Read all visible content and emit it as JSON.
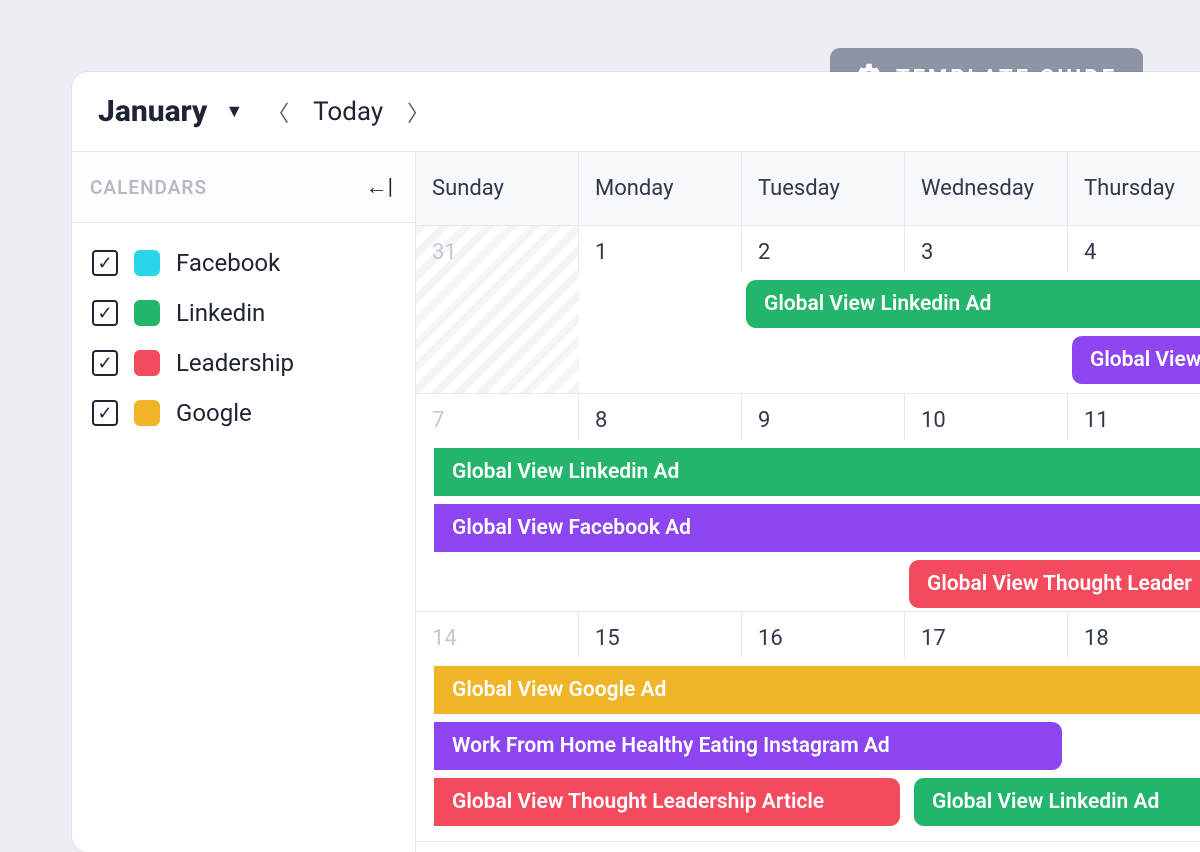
{
  "template_guide_label": "TEMPLATE GUIDE",
  "toolbar": {
    "month": "January",
    "today_label": "Today"
  },
  "sidebar": {
    "title": "CALENDARS",
    "items": [
      {
        "label": "Facebook",
        "color": "#29d5e8",
        "checked": true
      },
      {
        "label": "Linkedin",
        "color": "#24b56c",
        "checked": true
      },
      {
        "label": "Leadership",
        "color": "#f34a5e",
        "checked": true
      },
      {
        "label": "Google",
        "color": "#f0b429",
        "checked": true
      }
    ]
  },
  "day_headers": [
    "Sunday",
    "Monday",
    "Tuesday",
    "Wednesday",
    "Thursday"
  ],
  "weeks": [
    {
      "dates": [
        "31",
        "1",
        "2",
        "3",
        "4"
      ],
      "muted": [
        true,
        false,
        false,
        false,
        false
      ]
    },
    {
      "dates": [
        "7",
        "8",
        "9",
        "10",
        "11"
      ],
      "muted": [
        true,
        false,
        false,
        false,
        false
      ]
    },
    {
      "dates": [
        "14",
        "15",
        "16",
        "17",
        "18"
      ],
      "muted": [
        true,
        false,
        false,
        false,
        false
      ]
    }
  ],
  "events": {
    "w0": [
      {
        "label": "Global View Linkedin Ad",
        "color": "green"
      },
      {
        "label": "Global View",
        "color": "purple"
      }
    ],
    "w1": [
      {
        "label": "Global View Linkedin Ad",
        "color": "green"
      },
      {
        "label": "Global View Facebook Ad",
        "color": "purple"
      },
      {
        "label": "Global View Thought Leader",
        "color": "red"
      }
    ],
    "w2": [
      {
        "label": "Global View Google Ad",
        "color": "yellow"
      },
      {
        "label": "Work From Home Healthy Eating Instagram Ad",
        "color": "purple"
      },
      {
        "label": "Global View Thought Leadership Article",
        "color": "red"
      },
      {
        "label": "Global View Linkedin Ad",
        "color": "green"
      }
    ]
  }
}
